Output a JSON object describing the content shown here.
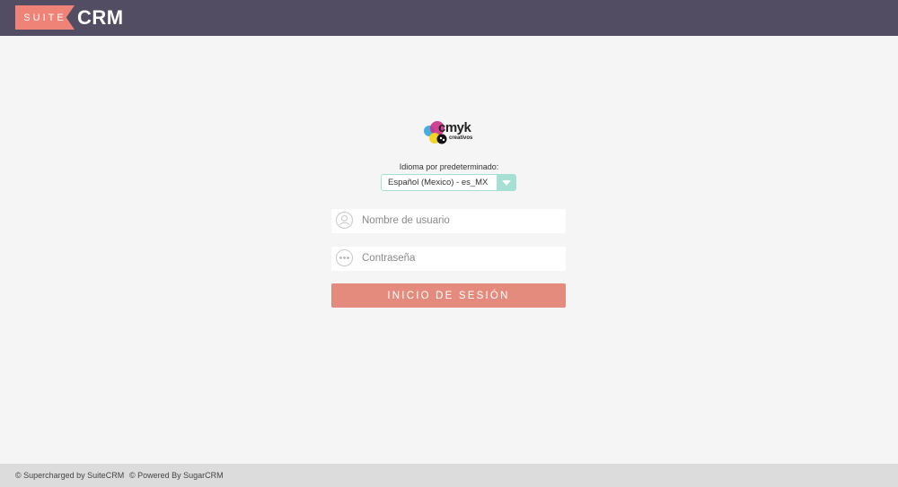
{
  "header": {
    "brand_suite": "SUITE",
    "brand_crm": "CRM"
  },
  "logo": {
    "text": "cmyk",
    "subtext": "creativos",
    "colors": [
      "#cc2f8a",
      "#35a6d8",
      "#f3d31a",
      "#111111"
    ]
  },
  "language": {
    "label": "Idioma por predeterminado:",
    "selected": "Español (Mexico) - es_MX"
  },
  "login": {
    "username_placeholder": "Nombre de usuario",
    "username_value": "",
    "password_placeholder": "Contraseña",
    "password_value": "",
    "submit_label": "INICIO DE SESIÓN"
  },
  "footer": {
    "supercharged": "© Supercharged by SuiteCRM",
    "powered": "© Powered By SugarCRM"
  },
  "colors": {
    "topbar": "#534d64",
    "accent": "#f08377",
    "button": "#e48b7e",
    "select_accent": "#a5e0d5"
  }
}
